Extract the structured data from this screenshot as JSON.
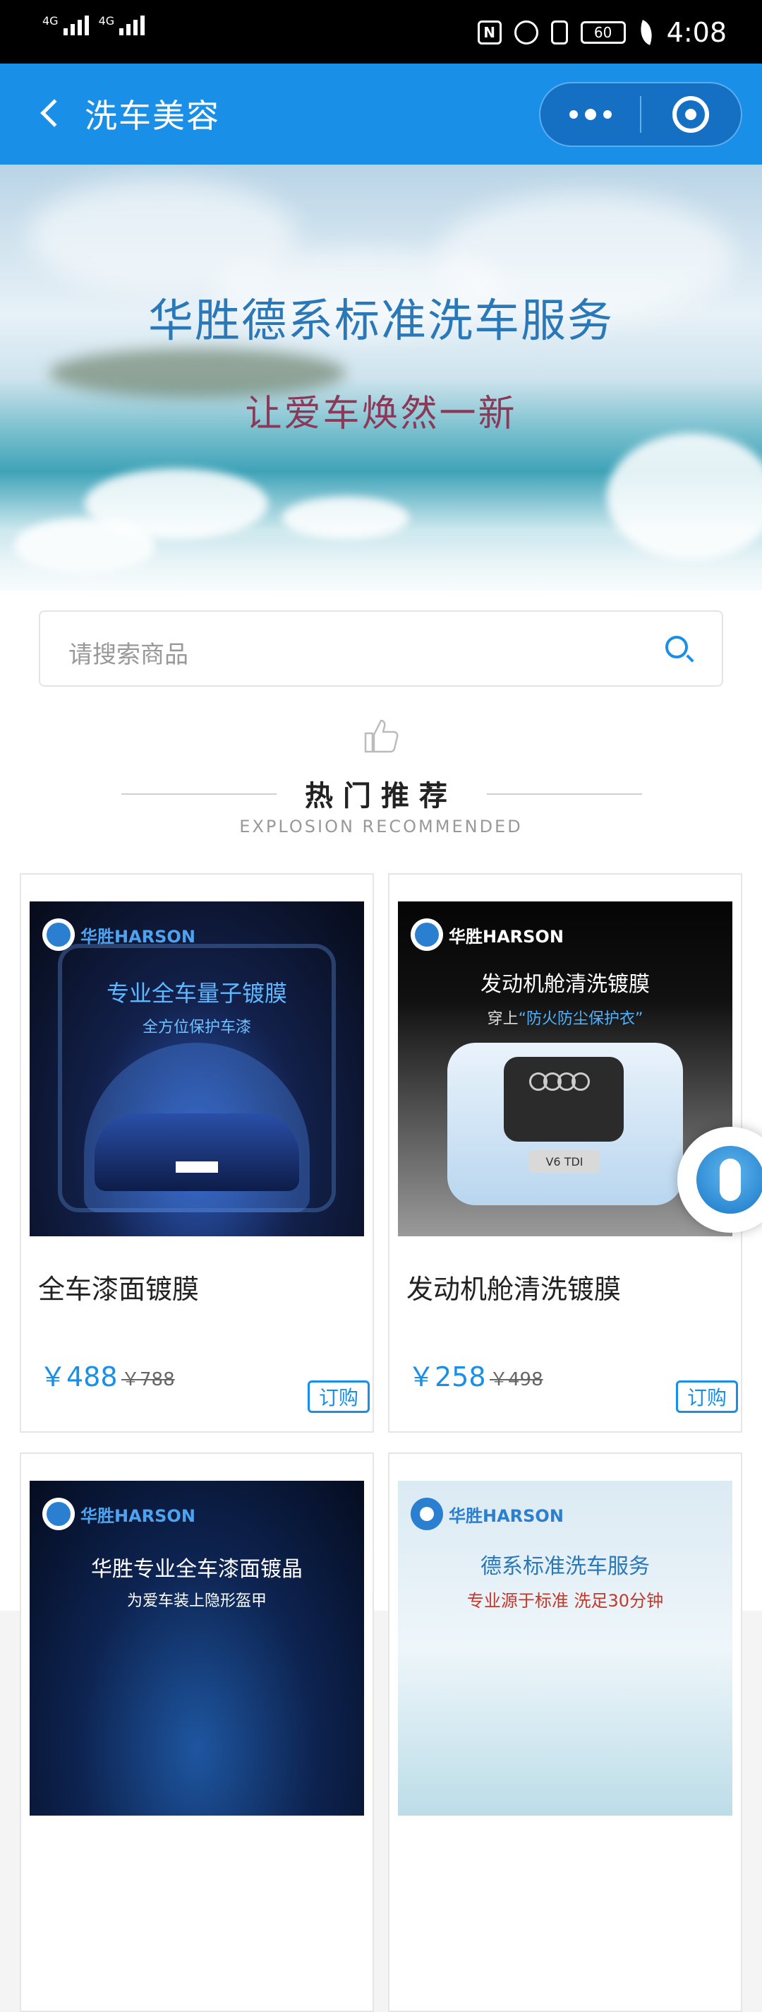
{
  "status_bar": {
    "signal1_label": "4G",
    "signal2_label": "4G",
    "nfc_label": "N",
    "battery": "60",
    "time": "4:08"
  },
  "nav": {
    "title": "洗车美容"
  },
  "banner": {
    "title": "华胜德系标准洗车服务",
    "subtitle": "让爱车焕然一新"
  },
  "search": {
    "placeholder": "请搜索商品"
  },
  "section": {
    "title": "热门推荐",
    "subtitle": "EXPLOSION RECOMMENDED"
  },
  "products": [
    {
      "brand": "华胜HARSON",
      "image_title": "专业全车量子镀膜",
      "image_subtitle": "全方位保护车漆",
      "name": "全车漆面镀膜",
      "price": "￥488",
      "old_price": "￥788",
      "order_label": "订购"
    },
    {
      "brand": "华胜HARSON",
      "image_title": "发动机舱清洗镀膜",
      "image_subtitle_prefix": "穿上",
      "image_subtitle_highlight": "“防火防尘保护衣”",
      "image_label": "V6 TDI",
      "name": "发动机舱清洗镀膜",
      "price": "￥258",
      "old_price": "￥498",
      "order_label": "订购"
    },
    {
      "brand": "华胜HARSON",
      "image_title": "华胜专业全车漆面镀晶",
      "image_subtitle": "为爱车装上隐形盔甲"
    },
    {
      "brand": "华胜HARSON",
      "image_title": "德系标准洗车服务",
      "image_subtitle": "专业源于标准 洗足30分钟"
    }
  ],
  "colors": {
    "primary": "#1a8fe8",
    "navbar": "#1a8fe8",
    "banner_title": "#2b78b9",
    "banner_subtitle": "#8a3a58"
  }
}
